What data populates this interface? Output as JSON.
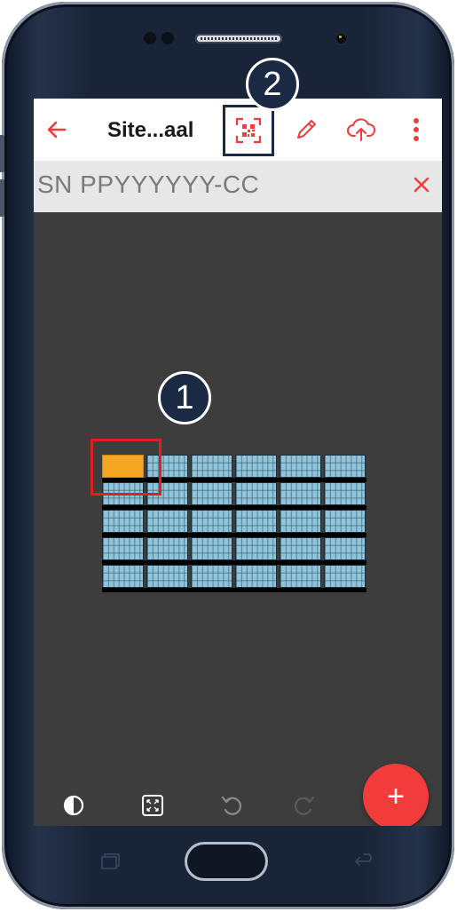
{
  "app": {
    "title": "Site...aal",
    "serial_text": "SN PPYYYYYY-CC",
    "colors": {
      "accent": "#f23b3b",
      "canvas": "#3d3d3d",
      "panel": "#8fc4da",
      "selected_panel": "#f5a623",
      "callout": "#1a2a45"
    }
  },
  "toolbar": {
    "icons": [
      "back-arrow-icon",
      "qr-scan-icon",
      "pencil-icon",
      "cloud-upload-icon",
      "more-vert-icon"
    ]
  },
  "callouts": {
    "one": "1",
    "two": "2"
  },
  "layout_grid": {
    "rows": 5,
    "columns": 6,
    "selected_panel": {
      "row": 1,
      "column": 1
    }
  },
  "bottom_bar": {
    "icons": [
      "contrast-icon",
      "fit-screen-icon",
      "undo-icon",
      "redo-icon"
    ],
    "fab_label": "+"
  },
  "device": {
    "nav_icons": [
      "recent-apps-icon",
      "home-button",
      "back-icon"
    ]
  }
}
